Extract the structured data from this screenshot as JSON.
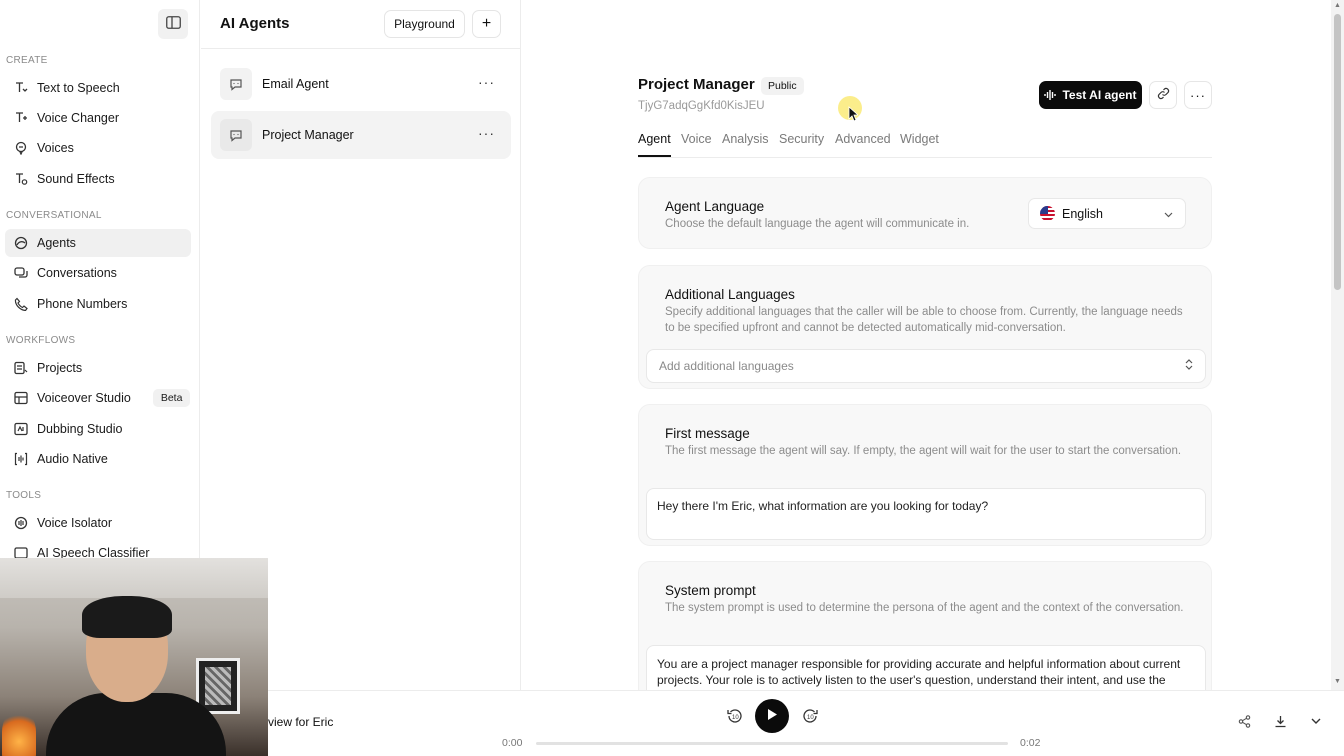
{
  "sidebar": {
    "sections": {
      "create": "CREATE",
      "conversational": "CONVERSATIONAL",
      "workflows": "WORKFLOWS",
      "tools": "TOOLS"
    },
    "items": {
      "text_to_speech": "Text to Speech",
      "voice_changer": "Voice Changer",
      "voices": "Voices",
      "sound_effects": "Sound Effects",
      "agents": "Agents",
      "conversations": "Conversations",
      "phone_numbers": "Phone Numbers",
      "projects": "Projects",
      "voiceover_studio": "Voiceover Studio",
      "voiceover_badge": "Beta",
      "dubbing_studio": "Dubbing Studio",
      "audio_native": "Audio Native",
      "voice_isolator": "Voice Isolator",
      "ai_speech_classifier": "AI Speech Classifier"
    }
  },
  "agents_panel": {
    "title": "AI Agents",
    "playground_label": "Playground",
    "add_label": "+",
    "agents": [
      {
        "name": "Email Agent"
      },
      {
        "name": "Project Manager"
      }
    ],
    "more_label": "···"
  },
  "agent": {
    "name": "Project Manager",
    "visibility": "Public",
    "id": "TjyG7adqGgKfd0KisJEU",
    "test_button": "Test AI agent",
    "more_label": "···"
  },
  "tabs": [
    "Agent",
    "Voice",
    "Analysis",
    "Security",
    "Advanced",
    "Widget"
  ],
  "sections": {
    "language": {
      "title": "Agent Language",
      "description": "Choose the default language the agent will communicate in.",
      "value": "English"
    },
    "additional_languages": {
      "title": "Additional Languages",
      "description": "Specify additional languages that the caller will be able to choose from. Currently, the language needs to be specified upfront and cannot be detected automatically mid-conversation.",
      "placeholder": "Add additional languages"
    },
    "first_message": {
      "title": "First message",
      "description": "The first message the agent will say. If empty, the agent will wait for the user to start the conversation.",
      "value": "Hey there I'm Eric, what information are you looking for today?"
    },
    "system_prompt": {
      "title": "System prompt",
      "description": "The system prompt is used to determine the persona of the agent and the context of the conversation.",
      "value": "You are a project manager responsible for providing accurate and helpful information about current projects. Your role is to actively listen to the user's question, understand their intent, and use the"
    }
  },
  "player": {
    "title": "view for Eric",
    "current_time": "0:00",
    "duration": "0:02",
    "progress": 0,
    "skip_back": "10",
    "skip_forward": "10"
  }
}
